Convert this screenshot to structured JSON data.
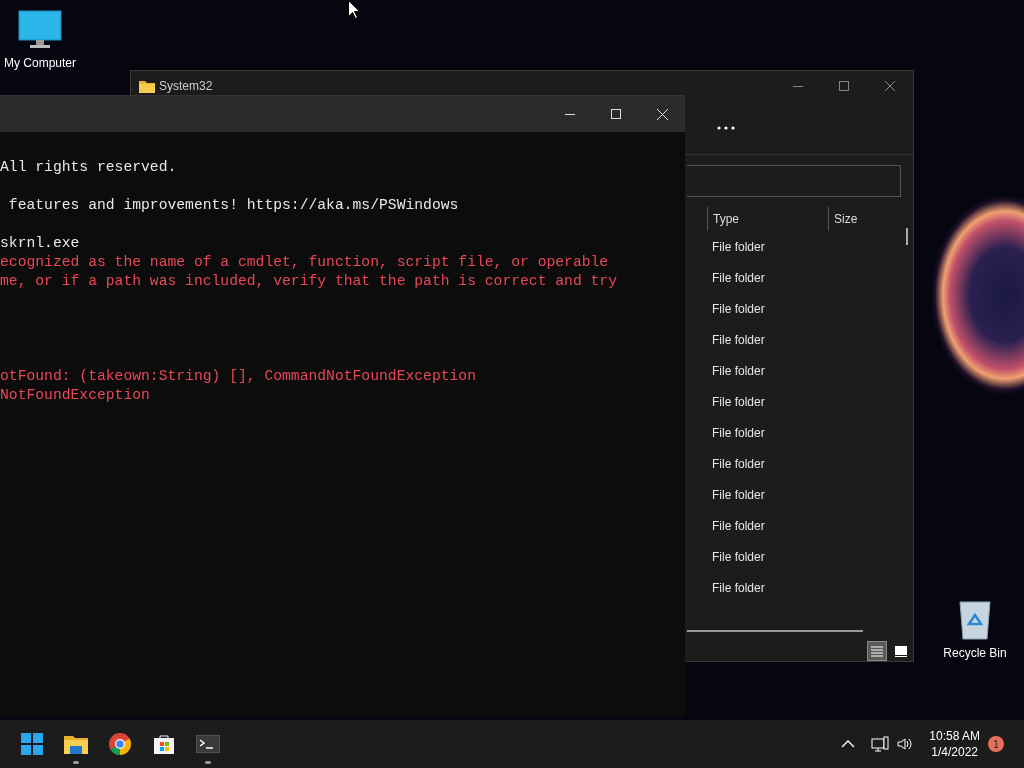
{
  "desktop_icons": [
    {
      "kind": "computer",
      "label": "My Computer"
    },
    {
      "kind": "recycle",
      "label": "Recycle Bin"
    }
  ],
  "explorer": {
    "title": "System32",
    "columns": [
      "Type",
      "Size"
    ],
    "rows": [
      {
        "type": "File folder"
      },
      {
        "type": "File folder"
      },
      {
        "type": "File folder"
      },
      {
        "type": "File folder"
      },
      {
        "type": "File folder"
      },
      {
        "type": "File folder"
      },
      {
        "type": "File folder"
      },
      {
        "type": "File folder"
      },
      {
        "type": "File folder"
      },
      {
        "type": "File folder"
      },
      {
        "type": "File folder"
      },
      {
        "type": "File folder"
      }
    ],
    "views": [
      {
        "kind": "details",
        "selected": true
      },
      {
        "kind": "tiles",
        "selected": false
      }
    ]
  },
  "terminal": {
    "blocks": [
      [
        {
          "kind": "output",
          "text": "All rights reserved."
        }
      ],
      [
        {
          "kind": "output",
          "text": " features and improvements! https://aka.ms/PSWindows"
        }
      ],
      [
        {
          "kind": "output",
          "text": "skrnl.exe"
        },
        {
          "kind": "error",
          "text": "ecognized as the name of a cmdlet, function, script file, or operable"
        },
        {
          "kind": "error",
          "text": "me, or if a path was included, verify that the path is correct and try"
        }
      ],
      [
        {
          "kind": "error",
          "text": "otFound: (takeown:String) [], CommandNotFoundException"
        },
        {
          "kind": "error",
          "text": "NotFoundException"
        }
      ]
    ]
  },
  "taskbar": {
    "apps": [
      {
        "kind": "start",
        "running": false
      },
      {
        "kind": "explorer",
        "running": true
      },
      {
        "kind": "chrome",
        "running": false
      },
      {
        "kind": "store",
        "running": false
      },
      {
        "kind": "terminal",
        "running": true
      }
    ],
    "time": "10:58 AM",
    "date": "1/4/2022",
    "notifications": "1"
  }
}
